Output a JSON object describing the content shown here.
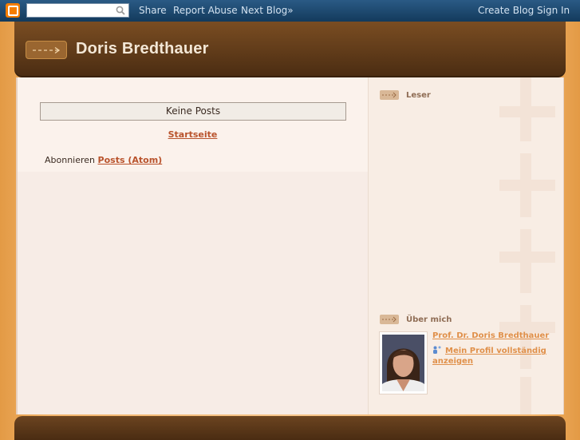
{
  "navbar": {
    "search_placeholder": "",
    "links": {
      "share": "Share",
      "report_abuse": "Report Abuse",
      "next_blog": "Next Blog»",
      "create_blog": "Create Blog",
      "sign_in": "Sign In"
    }
  },
  "header": {
    "title": "Doris Bredthauer"
  },
  "main": {
    "no_posts": "Keine Posts",
    "home_link": "Startseite",
    "subscribe_label": "Abonnieren",
    "subscribe_link": "Posts (Atom)"
  },
  "sidebar": {
    "followers_title": "Leser",
    "about_title": "Über mich",
    "profile_name": "Prof. Dr. Doris Bredthauer",
    "profile_link": "Mein Profil vollständig anzeigen"
  },
  "colors": {
    "navbar": "#1f4a72",
    "header": "#5e3a18",
    "link": "#b9532c",
    "sidebar_link": "#e0904a"
  }
}
